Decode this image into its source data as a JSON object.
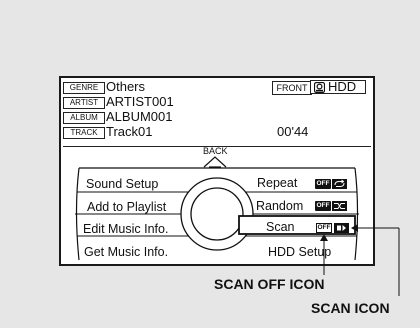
{
  "info": {
    "genre_tag": "GENRE",
    "genre_value": "Others",
    "artist_tag": "ARTIST",
    "artist_value": "ARTIST001",
    "album_tag": "ALBUM",
    "album_value": "ALBUM001",
    "track_tag": "TRACK",
    "track_value": "Track01",
    "elapsed_time": "00'44",
    "front_label": "FRONT",
    "source_label": "HDD"
  },
  "back_label": "BACK",
  "menu_left": [
    "Sound Setup",
    "Add to Playlist",
    "Edit Music Info.",
    "Get Music Info."
  ],
  "menu_right": {
    "repeat_label": "Repeat",
    "random_label": "Random",
    "scan_label": "Scan",
    "hdd_setup_label": "HDD Setup",
    "off_badge": "OFF"
  },
  "callouts": {
    "scan_off_icon": "SCAN OFF ICON",
    "scan_icon": "SCAN ICON"
  },
  "icons": [
    "hdd-icon",
    "back-arrow-icon",
    "repeat-icon",
    "random-icon",
    "scan-icon"
  ]
}
